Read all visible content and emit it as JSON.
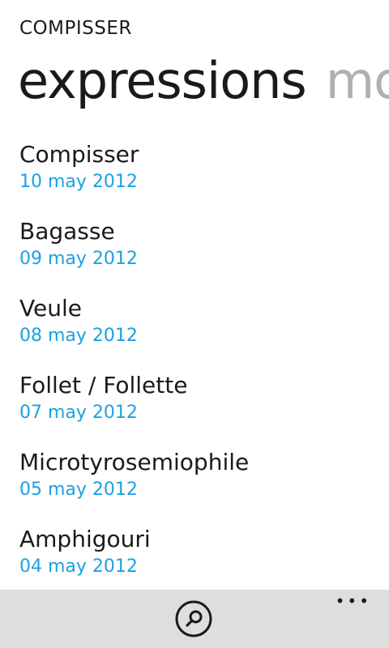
{
  "app": {
    "title": "COMPISSER"
  },
  "pivot": {
    "tabs": [
      {
        "label": "expressions"
      },
      {
        "label": "mots"
      }
    ]
  },
  "entries": [
    {
      "title": "Compisser",
      "date": "10 may 2012"
    },
    {
      "title": "Bagasse",
      "date": "09 may 2012"
    },
    {
      "title": "Veule",
      "date": "08 may 2012"
    },
    {
      "title": "Follet / Follette",
      "date": "07 may 2012"
    },
    {
      "title": "Microtyrosemiophile",
      "date": "05 may 2012"
    },
    {
      "title": "Amphigouri",
      "date": "04 may 2012"
    }
  ],
  "app_bar": {
    "search_icon": "search-icon",
    "more_label": "•••"
  },
  "colors": {
    "accent": "#1ba1e2",
    "app_bar_bg": "#dedede",
    "inactive_tab": "#b0b0b0"
  }
}
